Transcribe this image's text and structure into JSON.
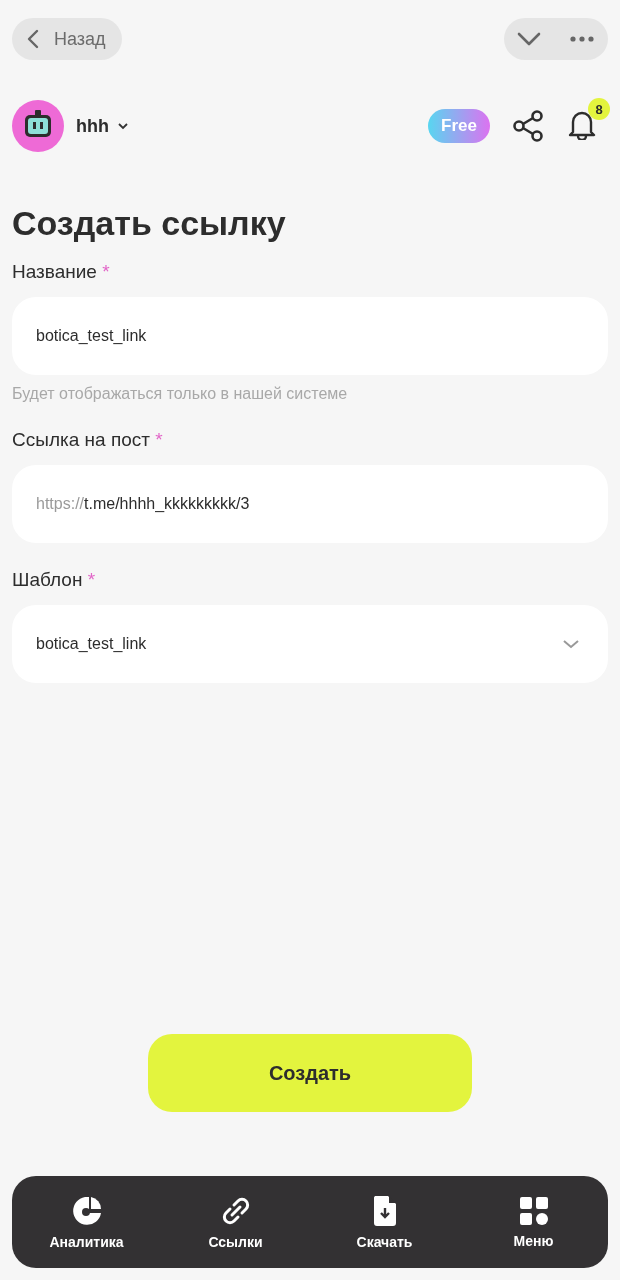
{
  "top_bar": {
    "back": "Назад"
  },
  "account": {
    "name": "hhh",
    "plan": "Free",
    "notifications": "8"
  },
  "title": "Создать ссылку",
  "fields": [
    {
      "kind": "input",
      "label": "Название",
      "required": "*",
      "value": "botica_test_link",
      "hint": "Будет отображаться только в нашей системе"
    },
    {
      "kind": "input",
      "label": "Ссылка на пост",
      "required": "*",
      "prefix": "https://",
      "value": "t.me/hhhh_kkkkkkkkk/3"
    },
    {
      "kind": "select",
      "label": "Шаблон",
      "required": "*",
      "value": "botica_test_link"
    }
  ],
  "submit": "Создать",
  "nav": [
    {
      "kind": "chart",
      "label": "Аналитика"
    },
    {
      "kind": "link",
      "label": "Ссылки"
    },
    {
      "kind": "download",
      "label": "Скачать"
    },
    {
      "kind": "grid",
      "label": "Меню"
    }
  ]
}
